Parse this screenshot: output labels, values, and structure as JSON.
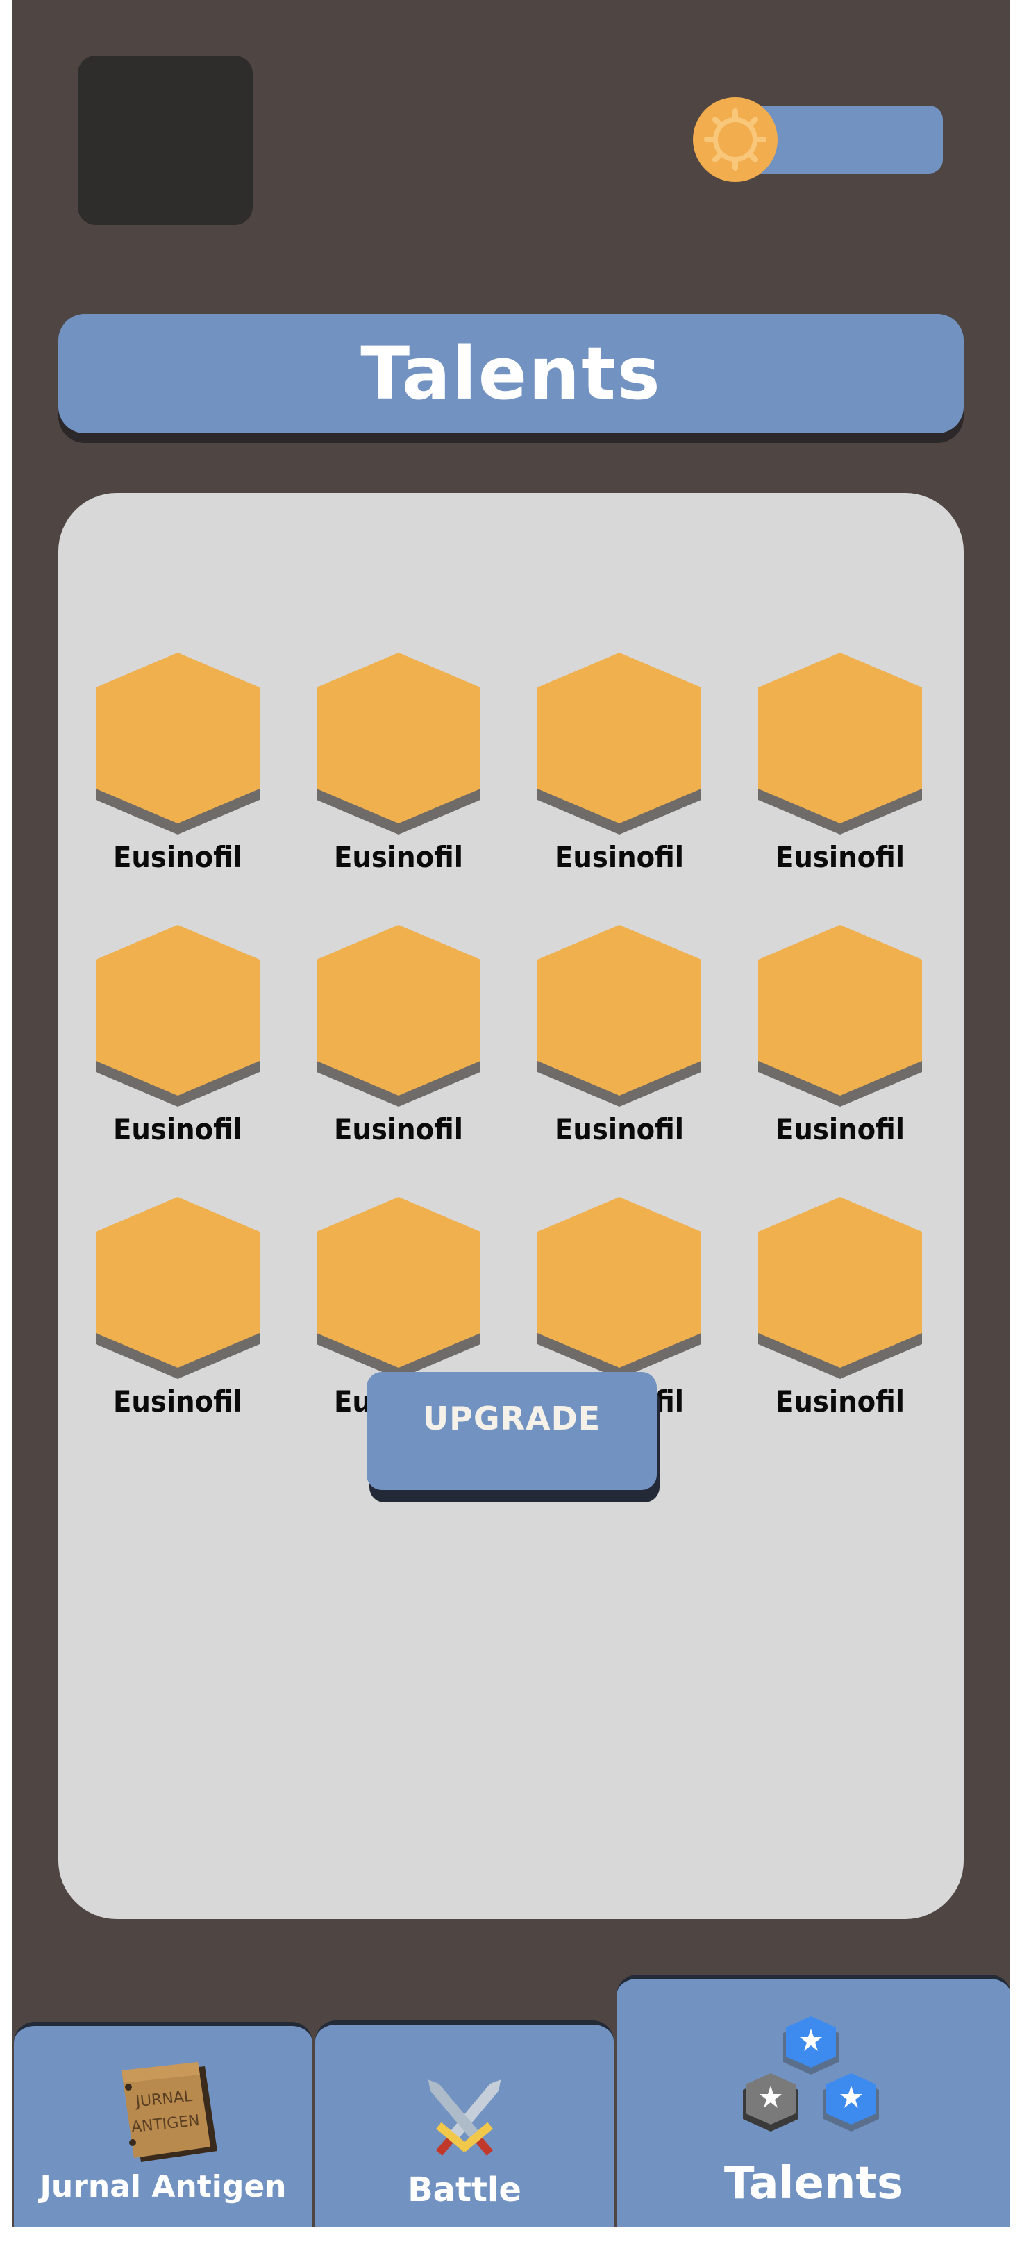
{
  "header": {
    "avatar": "avatar-placeholder",
    "coin_icon": "gear-coin-icon",
    "coin_amount": ""
  },
  "title": "Talents",
  "talents": [
    {
      "label": "Eusinofil"
    },
    {
      "label": "Eusinofil"
    },
    {
      "label": "Eusinofil"
    },
    {
      "label": "Eusinofil"
    },
    {
      "label": "Eusinofil"
    },
    {
      "label": "Eusinofil"
    },
    {
      "label": "Eusinofil"
    },
    {
      "label": "Eusinofil"
    },
    {
      "label": "Eusinofil"
    },
    {
      "label": "Eusinofil"
    },
    {
      "label": "Eusinofil"
    },
    {
      "label": "Eusinofil"
    }
  ],
  "upgrade_label": "UPGRADE",
  "book_text": {
    "line1": "JURNAL",
    "line2": "ANTIGEN"
  },
  "tabs": [
    {
      "label": "Jurnal Antigen",
      "icon": "book-icon",
      "active": false
    },
    {
      "label": "Battle",
      "icon": "crossed-swords-icon",
      "active": false
    },
    {
      "label": "Talents",
      "icon": "talent-hexes-icon",
      "active": true
    }
  ],
  "colors": {
    "background": "#4f4644",
    "accent_blue": "#7293c2",
    "hex_fill": "#efb04d",
    "hex_shadow": "#6f6b69",
    "panel": "#d8d8d8",
    "coin": "#f2ad4e"
  }
}
